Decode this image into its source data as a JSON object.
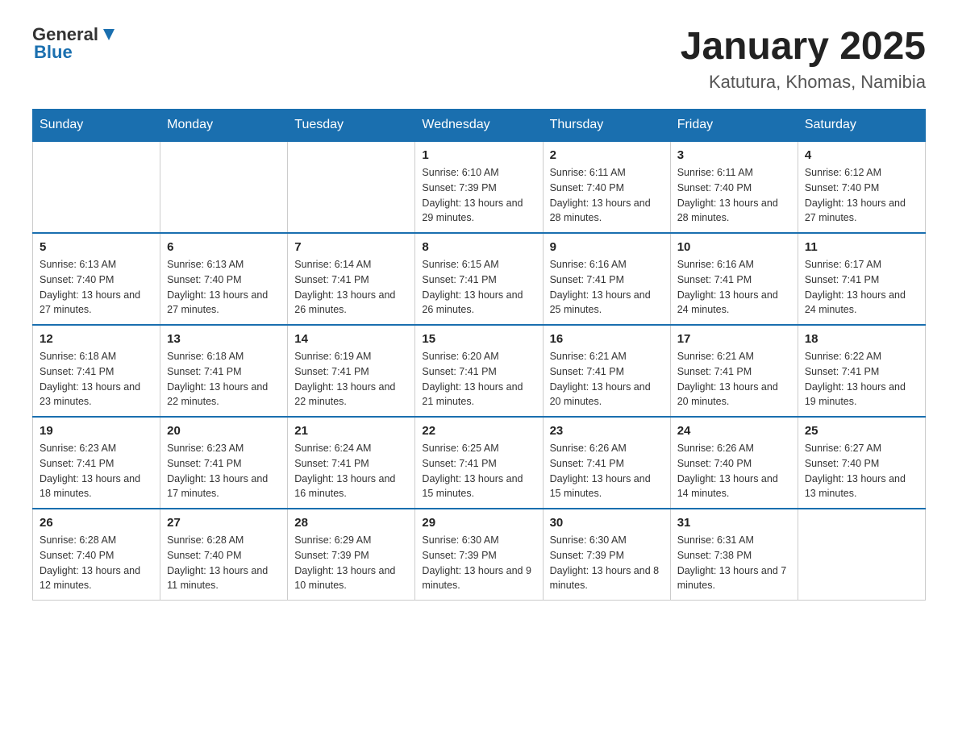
{
  "logo": {
    "general": "General",
    "blue": "Blue"
  },
  "title": "January 2025",
  "subtitle": "Katutura, Khomas, Namibia",
  "headers": [
    "Sunday",
    "Monday",
    "Tuesday",
    "Wednesday",
    "Thursday",
    "Friday",
    "Saturday"
  ],
  "weeks": [
    [
      {
        "day": "",
        "info": ""
      },
      {
        "day": "",
        "info": ""
      },
      {
        "day": "",
        "info": ""
      },
      {
        "day": "1",
        "info": "Sunrise: 6:10 AM\nSunset: 7:39 PM\nDaylight: 13 hours and 29 minutes."
      },
      {
        "day": "2",
        "info": "Sunrise: 6:11 AM\nSunset: 7:40 PM\nDaylight: 13 hours and 28 minutes."
      },
      {
        "day": "3",
        "info": "Sunrise: 6:11 AM\nSunset: 7:40 PM\nDaylight: 13 hours and 28 minutes."
      },
      {
        "day": "4",
        "info": "Sunrise: 6:12 AM\nSunset: 7:40 PM\nDaylight: 13 hours and 27 minutes."
      }
    ],
    [
      {
        "day": "5",
        "info": "Sunrise: 6:13 AM\nSunset: 7:40 PM\nDaylight: 13 hours and 27 minutes."
      },
      {
        "day": "6",
        "info": "Sunrise: 6:13 AM\nSunset: 7:40 PM\nDaylight: 13 hours and 27 minutes."
      },
      {
        "day": "7",
        "info": "Sunrise: 6:14 AM\nSunset: 7:41 PM\nDaylight: 13 hours and 26 minutes."
      },
      {
        "day": "8",
        "info": "Sunrise: 6:15 AM\nSunset: 7:41 PM\nDaylight: 13 hours and 26 minutes."
      },
      {
        "day": "9",
        "info": "Sunrise: 6:16 AM\nSunset: 7:41 PM\nDaylight: 13 hours and 25 minutes."
      },
      {
        "day": "10",
        "info": "Sunrise: 6:16 AM\nSunset: 7:41 PM\nDaylight: 13 hours and 24 minutes."
      },
      {
        "day": "11",
        "info": "Sunrise: 6:17 AM\nSunset: 7:41 PM\nDaylight: 13 hours and 24 minutes."
      }
    ],
    [
      {
        "day": "12",
        "info": "Sunrise: 6:18 AM\nSunset: 7:41 PM\nDaylight: 13 hours and 23 minutes."
      },
      {
        "day": "13",
        "info": "Sunrise: 6:18 AM\nSunset: 7:41 PM\nDaylight: 13 hours and 22 minutes."
      },
      {
        "day": "14",
        "info": "Sunrise: 6:19 AM\nSunset: 7:41 PM\nDaylight: 13 hours and 22 minutes."
      },
      {
        "day": "15",
        "info": "Sunrise: 6:20 AM\nSunset: 7:41 PM\nDaylight: 13 hours and 21 minutes."
      },
      {
        "day": "16",
        "info": "Sunrise: 6:21 AM\nSunset: 7:41 PM\nDaylight: 13 hours and 20 minutes."
      },
      {
        "day": "17",
        "info": "Sunrise: 6:21 AM\nSunset: 7:41 PM\nDaylight: 13 hours and 20 minutes."
      },
      {
        "day": "18",
        "info": "Sunrise: 6:22 AM\nSunset: 7:41 PM\nDaylight: 13 hours and 19 minutes."
      }
    ],
    [
      {
        "day": "19",
        "info": "Sunrise: 6:23 AM\nSunset: 7:41 PM\nDaylight: 13 hours and 18 minutes."
      },
      {
        "day": "20",
        "info": "Sunrise: 6:23 AM\nSunset: 7:41 PM\nDaylight: 13 hours and 17 minutes."
      },
      {
        "day": "21",
        "info": "Sunrise: 6:24 AM\nSunset: 7:41 PM\nDaylight: 13 hours and 16 minutes."
      },
      {
        "day": "22",
        "info": "Sunrise: 6:25 AM\nSunset: 7:41 PM\nDaylight: 13 hours and 15 minutes."
      },
      {
        "day": "23",
        "info": "Sunrise: 6:26 AM\nSunset: 7:41 PM\nDaylight: 13 hours and 15 minutes."
      },
      {
        "day": "24",
        "info": "Sunrise: 6:26 AM\nSunset: 7:40 PM\nDaylight: 13 hours and 14 minutes."
      },
      {
        "day": "25",
        "info": "Sunrise: 6:27 AM\nSunset: 7:40 PM\nDaylight: 13 hours and 13 minutes."
      }
    ],
    [
      {
        "day": "26",
        "info": "Sunrise: 6:28 AM\nSunset: 7:40 PM\nDaylight: 13 hours and 12 minutes."
      },
      {
        "day": "27",
        "info": "Sunrise: 6:28 AM\nSunset: 7:40 PM\nDaylight: 13 hours and 11 minutes."
      },
      {
        "day": "28",
        "info": "Sunrise: 6:29 AM\nSunset: 7:39 PM\nDaylight: 13 hours and 10 minutes."
      },
      {
        "day": "29",
        "info": "Sunrise: 6:30 AM\nSunset: 7:39 PM\nDaylight: 13 hours and 9 minutes."
      },
      {
        "day": "30",
        "info": "Sunrise: 6:30 AM\nSunset: 7:39 PM\nDaylight: 13 hours and 8 minutes."
      },
      {
        "day": "31",
        "info": "Sunrise: 6:31 AM\nSunset: 7:38 PM\nDaylight: 13 hours and 7 minutes."
      },
      {
        "day": "",
        "info": ""
      }
    ]
  ]
}
